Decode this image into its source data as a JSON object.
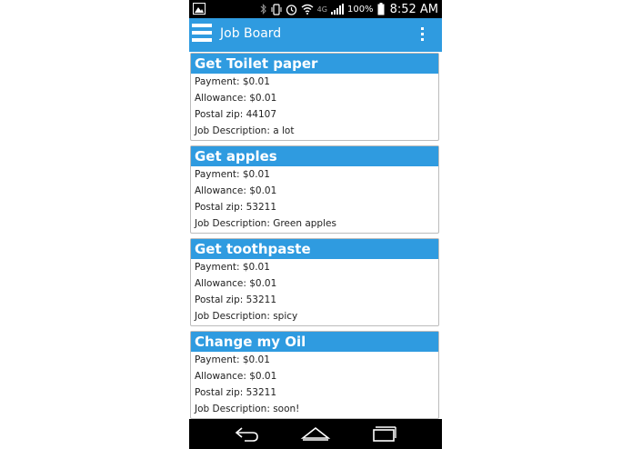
{
  "status_bar": {
    "network": "4G",
    "battery": "100%",
    "time": "8:52 AM"
  },
  "app_bar": {
    "title": "Job Board"
  },
  "jobs": [
    {
      "title": "Get Toilet paper",
      "payment": "Payment: $0.01",
      "allowance": "Allowance: $0.01",
      "zip": "Postal zip: 44107",
      "description": "Job Description: a lot"
    },
    {
      "title": "Get apples",
      "payment": "Payment: $0.01",
      "allowance": "Allowance: $0.01",
      "zip": "Postal zip: 53211",
      "description": "Job Description: Green apples"
    },
    {
      "title": "Get toothpaste",
      "payment": "Payment: $0.01",
      "allowance": "Allowance: $0.01",
      "zip": "Postal zip: 53211",
      "description": "Job Description: spicy"
    },
    {
      "title": "Change my Oil",
      "payment": "Payment: $0.01",
      "allowance": "Allowance: $0.01",
      "zip": "Postal zip: 53211",
      "description": "Job Description: soon!"
    }
  ],
  "icons": {
    "menu": "hamburger-menu-icon",
    "overflow": "more-vert-icon",
    "back": "back-icon",
    "home": "home-icon",
    "recents": "recents-icon"
  },
  "colors": {
    "accent": "#2f9be0",
    "status_bar": "#000000",
    "nav_bar": "#000000"
  }
}
